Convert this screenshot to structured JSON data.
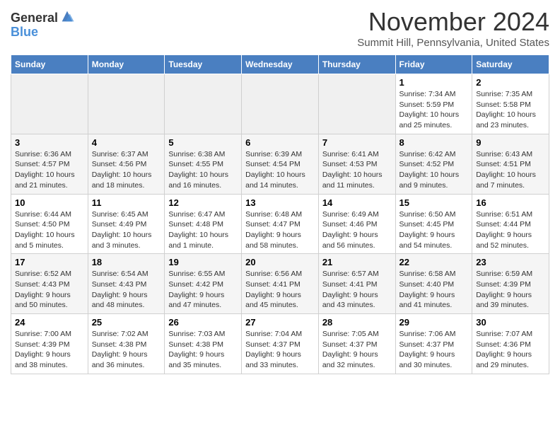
{
  "header": {
    "logo_general": "General",
    "logo_blue": "Blue",
    "month": "November 2024",
    "location": "Summit Hill, Pennsylvania, United States"
  },
  "days_of_week": [
    "Sunday",
    "Monday",
    "Tuesday",
    "Wednesday",
    "Thursday",
    "Friday",
    "Saturday"
  ],
  "weeks": [
    [
      {
        "day": "",
        "info": ""
      },
      {
        "day": "",
        "info": ""
      },
      {
        "day": "",
        "info": ""
      },
      {
        "day": "",
        "info": ""
      },
      {
        "day": "",
        "info": ""
      },
      {
        "day": "1",
        "info": "Sunrise: 7:34 AM\nSunset: 5:59 PM\nDaylight: 10 hours and 25 minutes."
      },
      {
        "day": "2",
        "info": "Sunrise: 7:35 AM\nSunset: 5:58 PM\nDaylight: 10 hours and 23 minutes."
      }
    ],
    [
      {
        "day": "3",
        "info": "Sunrise: 6:36 AM\nSunset: 4:57 PM\nDaylight: 10 hours and 21 minutes."
      },
      {
        "day": "4",
        "info": "Sunrise: 6:37 AM\nSunset: 4:56 PM\nDaylight: 10 hours and 18 minutes."
      },
      {
        "day": "5",
        "info": "Sunrise: 6:38 AM\nSunset: 4:55 PM\nDaylight: 10 hours and 16 minutes."
      },
      {
        "day": "6",
        "info": "Sunrise: 6:39 AM\nSunset: 4:54 PM\nDaylight: 10 hours and 14 minutes."
      },
      {
        "day": "7",
        "info": "Sunrise: 6:41 AM\nSunset: 4:53 PM\nDaylight: 10 hours and 11 minutes."
      },
      {
        "day": "8",
        "info": "Sunrise: 6:42 AM\nSunset: 4:52 PM\nDaylight: 10 hours and 9 minutes."
      },
      {
        "day": "9",
        "info": "Sunrise: 6:43 AM\nSunset: 4:51 PM\nDaylight: 10 hours and 7 minutes."
      }
    ],
    [
      {
        "day": "10",
        "info": "Sunrise: 6:44 AM\nSunset: 4:50 PM\nDaylight: 10 hours and 5 minutes."
      },
      {
        "day": "11",
        "info": "Sunrise: 6:45 AM\nSunset: 4:49 PM\nDaylight: 10 hours and 3 minutes."
      },
      {
        "day": "12",
        "info": "Sunrise: 6:47 AM\nSunset: 4:48 PM\nDaylight: 10 hours and 1 minute."
      },
      {
        "day": "13",
        "info": "Sunrise: 6:48 AM\nSunset: 4:47 PM\nDaylight: 9 hours and 58 minutes."
      },
      {
        "day": "14",
        "info": "Sunrise: 6:49 AM\nSunset: 4:46 PM\nDaylight: 9 hours and 56 minutes."
      },
      {
        "day": "15",
        "info": "Sunrise: 6:50 AM\nSunset: 4:45 PM\nDaylight: 9 hours and 54 minutes."
      },
      {
        "day": "16",
        "info": "Sunrise: 6:51 AM\nSunset: 4:44 PM\nDaylight: 9 hours and 52 minutes."
      }
    ],
    [
      {
        "day": "17",
        "info": "Sunrise: 6:52 AM\nSunset: 4:43 PM\nDaylight: 9 hours and 50 minutes."
      },
      {
        "day": "18",
        "info": "Sunrise: 6:54 AM\nSunset: 4:43 PM\nDaylight: 9 hours and 48 minutes."
      },
      {
        "day": "19",
        "info": "Sunrise: 6:55 AM\nSunset: 4:42 PM\nDaylight: 9 hours and 47 minutes."
      },
      {
        "day": "20",
        "info": "Sunrise: 6:56 AM\nSunset: 4:41 PM\nDaylight: 9 hours and 45 minutes."
      },
      {
        "day": "21",
        "info": "Sunrise: 6:57 AM\nSunset: 4:41 PM\nDaylight: 9 hours and 43 minutes."
      },
      {
        "day": "22",
        "info": "Sunrise: 6:58 AM\nSunset: 4:40 PM\nDaylight: 9 hours and 41 minutes."
      },
      {
        "day": "23",
        "info": "Sunrise: 6:59 AM\nSunset: 4:39 PM\nDaylight: 9 hours and 39 minutes."
      }
    ],
    [
      {
        "day": "24",
        "info": "Sunrise: 7:00 AM\nSunset: 4:39 PM\nDaylight: 9 hours and 38 minutes."
      },
      {
        "day": "25",
        "info": "Sunrise: 7:02 AM\nSunset: 4:38 PM\nDaylight: 9 hours and 36 minutes."
      },
      {
        "day": "26",
        "info": "Sunrise: 7:03 AM\nSunset: 4:38 PM\nDaylight: 9 hours and 35 minutes."
      },
      {
        "day": "27",
        "info": "Sunrise: 7:04 AM\nSunset: 4:37 PM\nDaylight: 9 hours and 33 minutes."
      },
      {
        "day": "28",
        "info": "Sunrise: 7:05 AM\nSunset: 4:37 PM\nDaylight: 9 hours and 32 minutes."
      },
      {
        "day": "29",
        "info": "Sunrise: 7:06 AM\nSunset: 4:37 PM\nDaylight: 9 hours and 30 minutes."
      },
      {
        "day": "30",
        "info": "Sunrise: 7:07 AM\nSunset: 4:36 PM\nDaylight: 9 hours and 29 minutes."
      }
    ]
  ]
}
